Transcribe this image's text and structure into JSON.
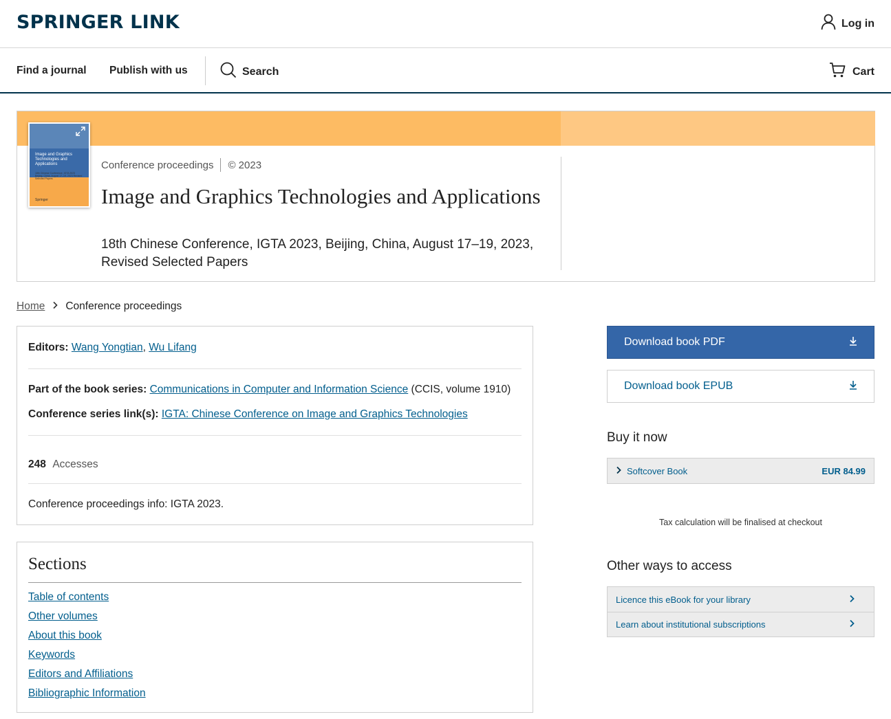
{
  "header": {
    "logo": "SPRINGER LINK",
    "login_label": "Log in"
  },
  "nav": {
    "find_journal": "Find a journal",
    "publish": "Publish with us",
    "search": "Search",
    "cart": "Cart"
  },
  "book": {
    "type": "Conference proceedings",
    "year": "© 2023",
    "title": "Image and Graphics Technologies and Applications",
    "subtitle": "18th Chinese Conference, IGTA 2023, Beijing, China, August 17–19, 2023, Revised Selected Papers",
    "cover": {
      "editors_line": "Wang Yongtian\nWu Lifang (Eds.)",
      "title": "Image and Graphics Technologies and Applications",
      "sub": "18th Chinese Conference, IGTA 2023 Beijing, China, August 17–19, 2023 Revised Selected Papers",
      "publisher": "Springer"
    }
  },
  "breadcrumb": {
    "home": "Home",
    "current": "Conference proceedings"
  },
  "info": {
    "editors_label": "Editors:",
    "editor1": "Wang Yongtian",
    "editor2": "Wu Lifang",
    "series_label": "Part of the book series:",
    "series_link": "Communications in Computer and Information Science",
    "series_suffix": "(CCIS, volume 1910)",
    "conf_label": "Conference series link(s):",
    "conf_link": "IGTA: Chinese Conference on Image and Graphics Technologies",
    "accesses_count": "248",
    "accesses_label": "Accesses",
    "conf_info": "Conference proceedings info: IGTA 2023."
  },
  "sections": {
    "heading": "Sections",
    "items": [
      "Table of contents",
      "Other volumes",
      "About this book",
      "Keywords",
      "Editors and Affiliations",
      "Bibliographic Information"
    ]
  },
  "sidebar": {
    "download_pdf": "Download book PDF",
    "download_epub": "Download book EPUB",
    "buy_heading": "Buy it now",
    "buy_item": "Softcover Book",
    "buy_price": "EUR 84.99",
    "tax_note": "Tax calculation will be finalised at checkout",
    "other_heading": "Other ways to access",
    "licence": "Licence this eBook for your library",
    "institutional": "Learn about institutional subscriptions"
  },
  "colors": {
    "brand": "#01324b",
    "link": "#025e8d",
    "primary_button": "#3466a8",
    "hero_band": "#fdbb63"
  }
}
